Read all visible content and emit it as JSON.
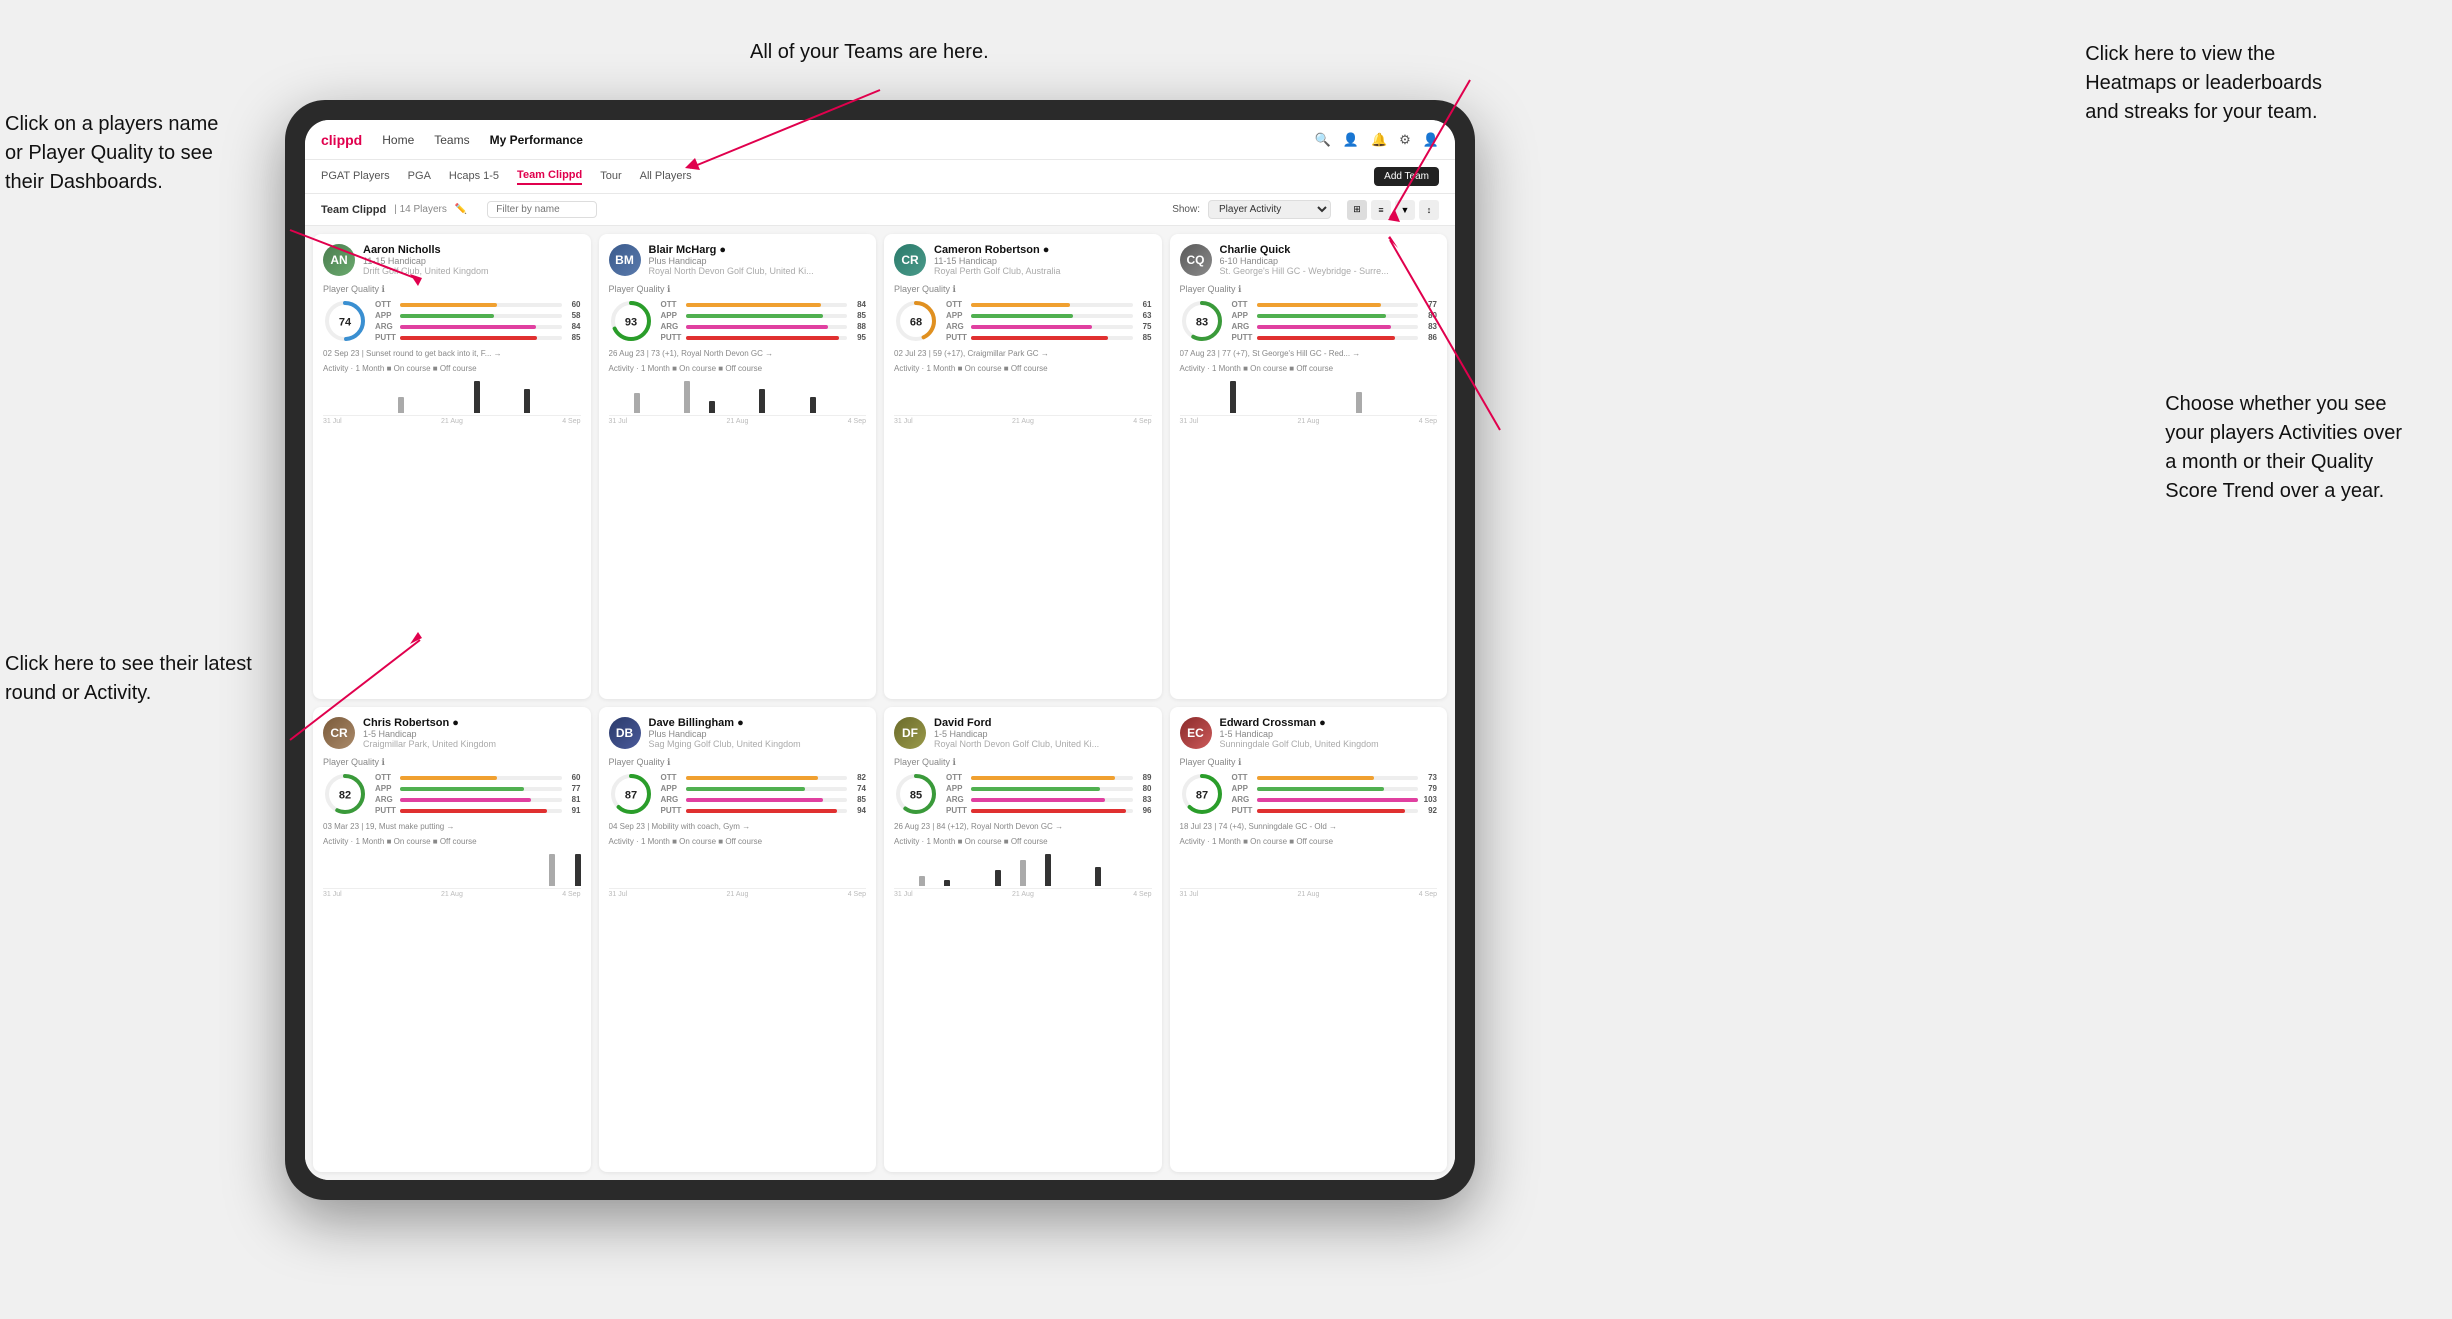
{
  "annotations": {
    "top_center": "All of your Teams are here.",
    "top_right": "Click here to view the\nHeatmaps or leaderboards\nand streaks for your team.",
    "left_top": "Click on a players name\nor Player Quality to see\ntheir Dashboards.",
    "left_bottom": "Click here to see their latest\nround or Activity.",
    "right_bottom": "Choose whether you see\nyour players Activities over\na month or their Quality\nScore Trend over a year."
  },
  "nav": {
    "logo": "clippd",
    "links": [
      "Home",
      "Teams",
      "My Performance"
    ],
    "active": "Teams"
  },
  "sub_nav": {
    "links": [
      "PGAT Players",
      "PGA",
      "Hcaps 1-5",
      "Team Clippd",
      "Tour",
      "All Players"
    ],
    "active": "Team Clippd"
  },
  "team_bar": {
    "title": "Team Clippd",
    "player_count": "14 Players",
    "filter_placeholder": "Filter by name",
    "show_label": "Show:",
    "show_value": "Player Activity",
    "add_team": "Add Team"
  },
  "players": [
    {
      "name": "Aaron Nicholls",
      "handicap": "11-15 Handicap",
      "club": "Drift Golf Club, United Kingdom",
      "avatar_color": "green",
      "quality": 74,
      "quality_color": "#3a8fd1",
      "stats": {
        "OTT": {
          "val": 60,
          "pct": 60
        },
        "APP": {
          "val": 58,
          "pct": 58
        },
        "ARG": {
          "val": 84,
          "pct": 84
        },
        "PUTT": {
          "val": 85,
          "pct": 85
        }
      },
      "last_round": "02 Sep 23 | Sunset round to get back into it, F...",
      "activity_label": "Activity · 1 Month ■ On course ■ Off course",
      "chart": [
        0,
        0,
        0,
        2,
        0,
        0,
        4,
        0,
        3,
        0,
        0
      ],
      "dates": [
        "31 Jul",
        "21 Aug",
        "4 Sep"
      ]
    },
    {
      "name": "Blair McHarg",
      "handicap": "Plus Handicap",
      "club": "Royal North Devon Golf Club, United Ki...",
      "avatar_color": "blue",
      "quality": 93,
      "quality_color": "#2a9d2a",
      "stats": {
        "OTT": {
          "val": 84,
          "pct": 84
        },
        "APP": {
          "val": 85,
          "pct": 85
        },
        "ARG": {
          "val": 88,
          "pct": 88
        },
        "PUTT": {
          "val": 95,
          "pct": 95
        }
      },
      "last_round": "26 Aug 23 | 73 (+1), Royal North Devon GC",
      "activity_label": "Activity · 1 Month ■ On course ■ Off course",
      "chart": [
        0,
        5,
        0,
        8,
        3,
        0,
        6,
        0,
        4,
        0,
        0
      ],
      "dates": [
        "31 Jul",
        "21 Aug",
        "4 Sep"
      ]
    },
    {
      "name": "Cameron Robertson",
      "handicap": "11-15 Handicap",
      "club": "Royal Perth Golf Club, Australia",
      "avatar_color": "teal",
      "quality": 68,
      "quality_color": "#e09020",
      "stats": {
        "OTT": {
          "val": 61,
          "pct": 61
        },
        "APP": {
          "val": 63,
          "pct": 63
        },
        "ARG": {
          "val": 75,
          "pct": 75
        },
        "PUTT": {
          "val": 85,
          "pct": 85
        }
      },
      "last_round": "02 Jul 23 | 59 (+17), Craigmillar Park GC",
      "activity_label": "Activity · 1 Month ■ On course ■ Off course",
      "chart": [
        0,
        0,
        0,
        0,
        0,
        0,
        0,
        0,
        0,
        0,
        0
      ],
      "dates": [
        "31 Jul",
        "21 Aug",
        "4 Sep"
      ]
    },
    {
      "name": "Charlie Quick",
      "handicap": "6-10 Handicap",
      "club": "St. George's Hill GC - Weybridge - Surre...",
      "avatar_color": "gray",
      "quality": 83,
      "quality_color": "#3a9a3a",
      "stats": {
        "OTT": {
          "val": 77,
          "pct": 77
        },
        "APP": {
          "val": 80,
          "pct": 80
        },
        "ARG": {
          "val": 83,
          "pct": 83
        },
        "PUTT": {
          "val": 86,
          "pct": 86
        }
      },
      "last_round": "07 Aug 23 | 77 (+7), St George's Hill GC - Red...",
      "activity_label": "Activity · 1 Month ■ On course ■ Off course",
      "chart": [
        0,
        0,
        3,
        0,
        0,
        0,
        0,
        2,
        0,
        0,
        0
      ],
      "dates": [
        "31 Jul",
        "21 Aug",
        "4 Sep"
      ]
    },
    {
      "name": "Chris Robertson",
      "handicap": "1-5 Handicap",
      "club": "Craigmillar Park, United Kingdom",
      "avatar_color": "brown",
      "quality": 82,
      "quality_color": "#3a9a3a",
      "stats": {
        "OTT": {
          "val": 60,
          "pct": 60
        },
        "APP": {
          "val": 77,
          "pct": 77
        },
        "ARG": {
          "val": 81,
          "pct": 81
        },
        "PUTT": {
          "val": 91,
          "pct": 91
        }
      },
      "last_round": "03 Mar 23 | 19, Must make putting",
      "activity_label": "Activity · 1 Month ■ On course ■ Off course",
      "chart": [
        0,
        0,
        0,
        0,
        0,
        0,
        0,
        0,
        0,
        4,
        4
      ],
      "dates": [
        "31 Jul",
        "21 Aug",
        "4 Sep"
      ]
    },
    {
      "name": "Dave Billingham",
      "handicap": "Plus Handicap",
      "club": "Sag Mging Golf Club, United Kingdom",
      "avatar_color": "navy",
      "quality": 87,
      "quality_color": "#2a9d2a",
      "stats": {
        "OTT": {
          "val": 82,
          "pct": 82
        },
        "APP": {
          "val": 74,
          "pct": 74
        },
        "ARG": {
          "val": 85,
          "pct": 85
        },
        "PUTT": {
          "val": 94,
          "pct": 94
        }
      },
      "last_round": "04 Sep 23 | Mobility with coach, Gym",
      "activity_label": "Activity · 1 Month ■ On course ■ Off course",
      "chart": [
        0,
        0,
        0,
        0,
        0,
        0,
        0,
        0,
        0,
        0,
        0
      ],
      "dates": [
        "31 Jul",
        "21 Aug",
        "4 Sep"
      ]
    },
    {
      "name": "David Ford",
      "handicap": "1-5 Handicap",
      "club": "Royal North Devon Golf Club, United Ki...",
      "avatar_color": "olive",
      "quality": 85,
      "quality_color": "#3a9a3a",
      "stats": {
        "OTT": {
          "val": 89,
          "pct": 89
        },
        "APP": {
          "val": 80,
          "pct": 80
        },
        "ARG": {
          "val": 83,
          "pct": 83
        },
        "PUTT": {
          "val": 96,
          "pct": 96
        }
      },
      "last_round": "26 Aug 23 | 84 (+12), Royal North Devon GC",
      "activity_label": "Activity · 1 Month ■ On course ■ Off course",
      "chart": [
        0,
        3,
        2,
        0,
        5,
        8,
        10,
        0,
        6,
        0,
        0
      ],
      "dates": [
        "31 Jul",
        "21 Aug",
        "4 Sep"
      ]
    },
    {
      "name": "Edward Crossman",
      "handicap": "1-5 Handicap",
      "club": "Sunningdale Golf Club, United Kingdom",
      "avatar_color": "red",
      "quality": 87,
      "quality_color": "#2a9d2a",
      "stats": {
        "OTT": {
          "val": 73,
          "pct": 73
        },
        "APP": {
          "val": 79,
          "pct": 79
        },
        "ARG": {
          "val": 103,
          "pct": 100
        },
        "PUTT": {
          "val": 92,
          "pct": 92
        }
      },
      "last_round": "18 Jul 23 | 74 (+4), Sunningdale GC - Old",
      "activity_label": "Activity · 1 Month ■ On course ■ Off course",
      "chart": [
        0,
        0,
        0,
        0,
        0,
        0,
        0,
        0,
        0,
        0,
        0
      ],
      "dates": [
        "31 Jul",
        "21 Aug",
        "4 Sep"
      ]
    }
  ]
}
